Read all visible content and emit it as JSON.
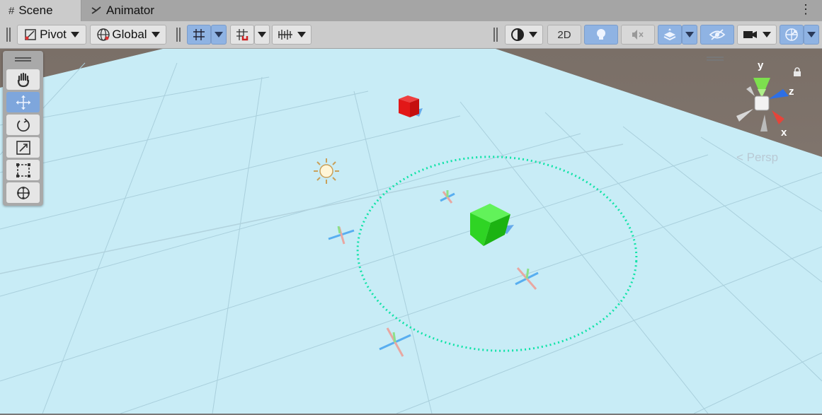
{
  "tabs": [
    {
      "label": "Scene",
      "icon": "grid-icon",
      "active": true
    },
    {
      "label": "Animator",
      "icon": "animator-icon",
      "active": false
    }
  ],
  "toolbar": {
    "pivot_label": "Pivot",
    "global_label": "Global",
    "twod_label": "2D"
  },
  "tools": [
    "hand-tool",
    "move-tool",
    "rotate-tool",
    "scale-tool",
    "rect-tool",
    "transform-tool"
  ],
  "selected_tool": "move-tool",
  "gizmo": {
    "y_label": "y",
    "z_label": "z",
    "x_label": "x",
    "projection_label": "< Persp"
  },
  "colors": {
    "plane": "#c8ecf6",
    "background": "#857a72",
    "red_cube": "#e21818",
    "green_cube": "#2fd424",
    "circle": "#11e3a8",
    "accent": "#8fb3e3"
  }
}
